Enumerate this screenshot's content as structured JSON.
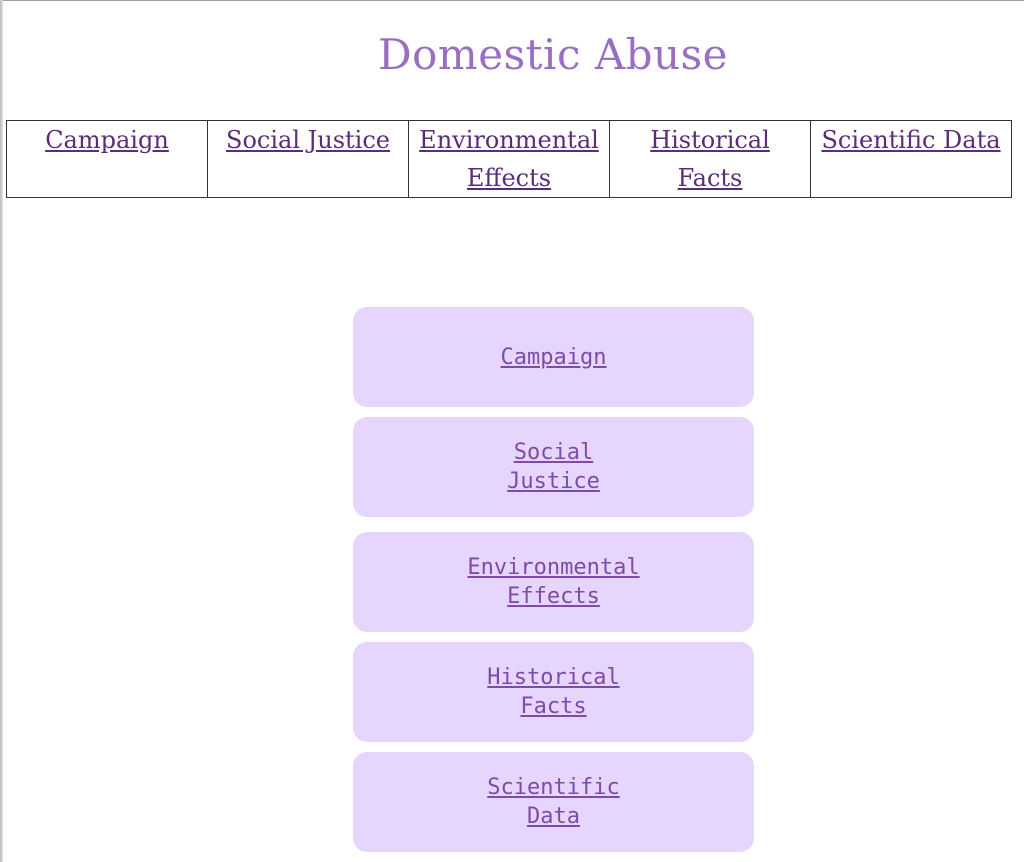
{
  "page": {
    "title": "Domestic Abuse"
  },
  "nav": {
    "items": [
      {
        "label": "Campaign"
      },
      {
        "label": "Social Justice"
      },
      {
        "label": "Environmental Effects"
      },
      {
        "label": "Historical Facts"
      },
      {
        "label": "Scientific Data"
      }
    ]
  },
  "menu": {
    "items": [
      {
        "label": "Campaign"
      },
      {
        "label": "Social Justice"
      },
      {
        "label": "Environmental Effects"
      },
      {
        "label": "Historical Facts"
      },
      {
        "label": "Scientific Data"
      }
    ]
  },
  "colors": {
    "title": "#9a6fc3",
    "nav_link": "#5b2c7a",
    "menu_background": "#e6d5fd",
    "menu_link": "#7d4ca8"
  }
}
